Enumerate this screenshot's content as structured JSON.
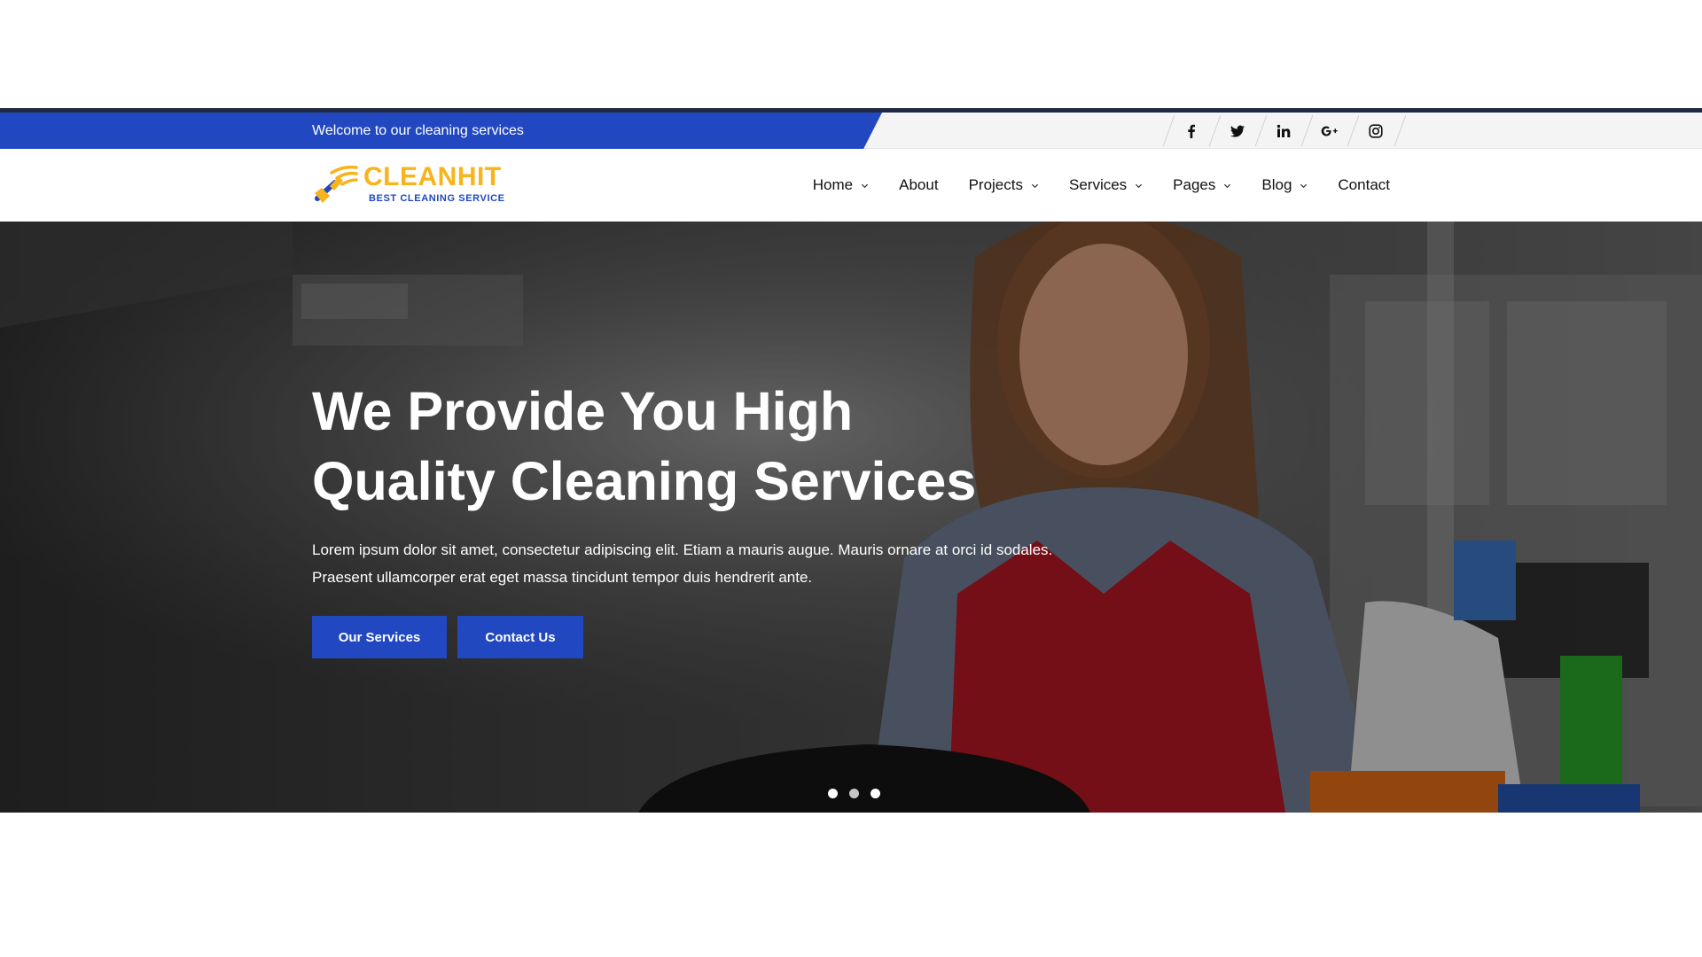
{
  "topbar": {
    "welcome_text": "Welcome to our cleaning services",
    "social": [
      {
        "name": "facebook-icon"
      },
      {
        "name": "twitter-icon"
      },
      {
        "name": "linkedin-icon"
      },
      {
        "name": "google-plus-icon"
      },
      {
        "name": "instagram-icon"
      }
    ]
  },
  "brand": {
    "name": "CLEANHIT",
    "tagline": "BEST CLEANING SERVICE",
    "colors": {
      "primary": "#2148c0",
      "accent": "#f7b41c"
    }
  },
  "nav": {
    "items": [
      {
        "label": "Home",
        "has_dropdown": true
      },
      {
        "label": "About",
        "has_dropdown": false
      },
      {
        "label": "Projects",
        "has_dropdown": true
      },
      {
        "label": "Services",
        "has_dropdown": true
      },
      {
        "label": "Pages",
        "has_dropdown": true
      },
      {
        "label": "Blog",
        "has_dropdown": true
      },
      {
        "label": "Contact",
        "has_dropdown": false
      }
    ]
  },
  "hero": {
    "title_line1": "We Provide You High",
    "title_line2": "Quality Cleaning Services",
    "text_line1": "Lorem ipsum dolor sit amet, consectetur adipiscing elit. Etiam a mauris augue. Mauris ornare at orci id sodales.",
    "text_line2": "Praesent ullamcorper erat eget massa tincidunt tempor duis hendrerit ante.",
    "buttons": {
      "primary": "Our Services",
      "secondary": "Contact Us"
    },
    "slider": {
      "count": 3,
      "active_index": 1
    }
  }
}
